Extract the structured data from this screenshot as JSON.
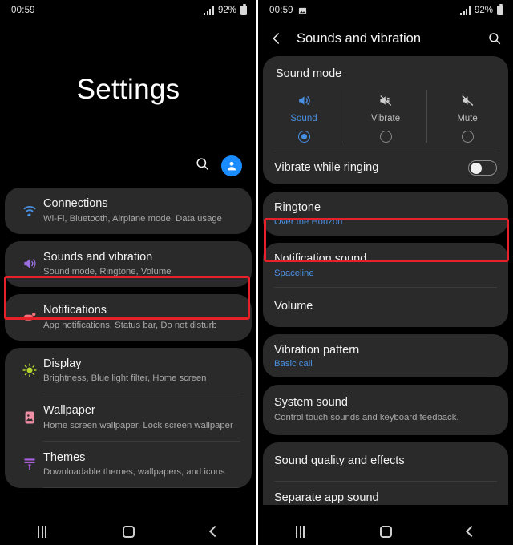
{
  "left": {
    "statusbar": {
      "time": "00:59",
      "battery_percent": "92%",
      "signal_icon": "signal-bars-icon",
      "battery_icon": "battery-icon"
    },
    "page_title": "Settings",
    "actions": {
      "search_icon": "search-icon",
      "account_icon": "account-avatar-icon"
    },
    "groups": [
      {
        "rows": [
          {
            "icon": "wifi-icon",
            "title": "Connections",
            "subtitle": "Wi-Fi, Bluetooth, Airplane mode, Data usage"
          }
        ]
      },
      {
        "rows": [
          {
            "icon": "volume-icon",
            "title": "Sounds and vibration",
            "subtitle": "Sound mode, Ringtone, Volume"
          }
        ]
      },
      {
        "rows": [
          {
            "icon": "notification-icon",
            "title": "Notifications",
            "subtitle": "App notifications, Status bar, Do not disturb"
          }
        ]
      },
      {
        "rows": [
          {
            "icon": "brightness-icon",
            "title": "Display",
            "subtitle": "Brightness, Blue light filter, Home screen"
          },
          {
            "icon": "wallpaper-icon",
            "title": "Wallpaper",
            "subtitle": "Home screen wallpaper, Lock screen wallpaper"
          },
          {
            "icon": "themes-icon",
            "title": "Themes",
            "subtitle": "Downloadable themes, wallpapers, and icons"
          }
        ]
      }
    ],
    "highlight": "sounds-and-vibration",
    "navbar": {
      "recents": "recents-icon",
      "home": "home-icon",
      "back": "back-icon"
    }
  },
  "right": {
    "statusbar": {
      "time": "00:59",
      "battery_percent": "92%",
      "image_icon": "image-icon",
      "signal_icon": "signal-bars-icon",
      "battery_icon": "battery-icon"
    },
    "appbar": {
      "back_icon": "back-chevron-icon",
      "title": "Sounds and vibration",
      "search_icon": "search-icon"
    },
    "sound_mode": {
      "header": "Sound mode",
      "options": [
        {
          "label": "Sound",
          "icon": "speaker-on-icon",
          "selected": true
        },
        {
          "label": "Vibrate",
          "icon": "vibrate-icon",
          "selected": false
        },
        {
          "label": "Mute",
          "icon": "speaker-mute-icon",
          "selected": false
        }
      ]
    },
    "vibrate_while_ringing": {
      "label": "Vibrate while ringing",
      "enabled": false
    },
    "items": [
      {
        "title": "Ringtone",
        "value": "Over the Horizon",
        "highlighted": true
      },
      {
        "title": "Notification sound",
        "value": "Spaceline"
      },
      {
        "title": "Volume",
        "value": ""
      },
      {
        "title": "Vibration pattern",
        "value": "Basic call"
      },
      {
        "title": "System sound",
        "subtitle": "Control touch sounds and keyboard feedback."
      },
      {
        "title": "Sound quality and effects",
        "value": ""
      },
      {
        "title": "Separate app sound",
        "value": ""
      }
    ],
    "navbar": {
      "recents": "recents-icon",
      "home": "home-icon",
      "back": "back-icon"
    }
  },
  "colors": {
    "accent_blue": "#4a90e2",
    "highlight_red": "#e8202a",
    "card_bg": "#2a2a2a",
    "avatar_blue": "#1a8cff"
  }
}
